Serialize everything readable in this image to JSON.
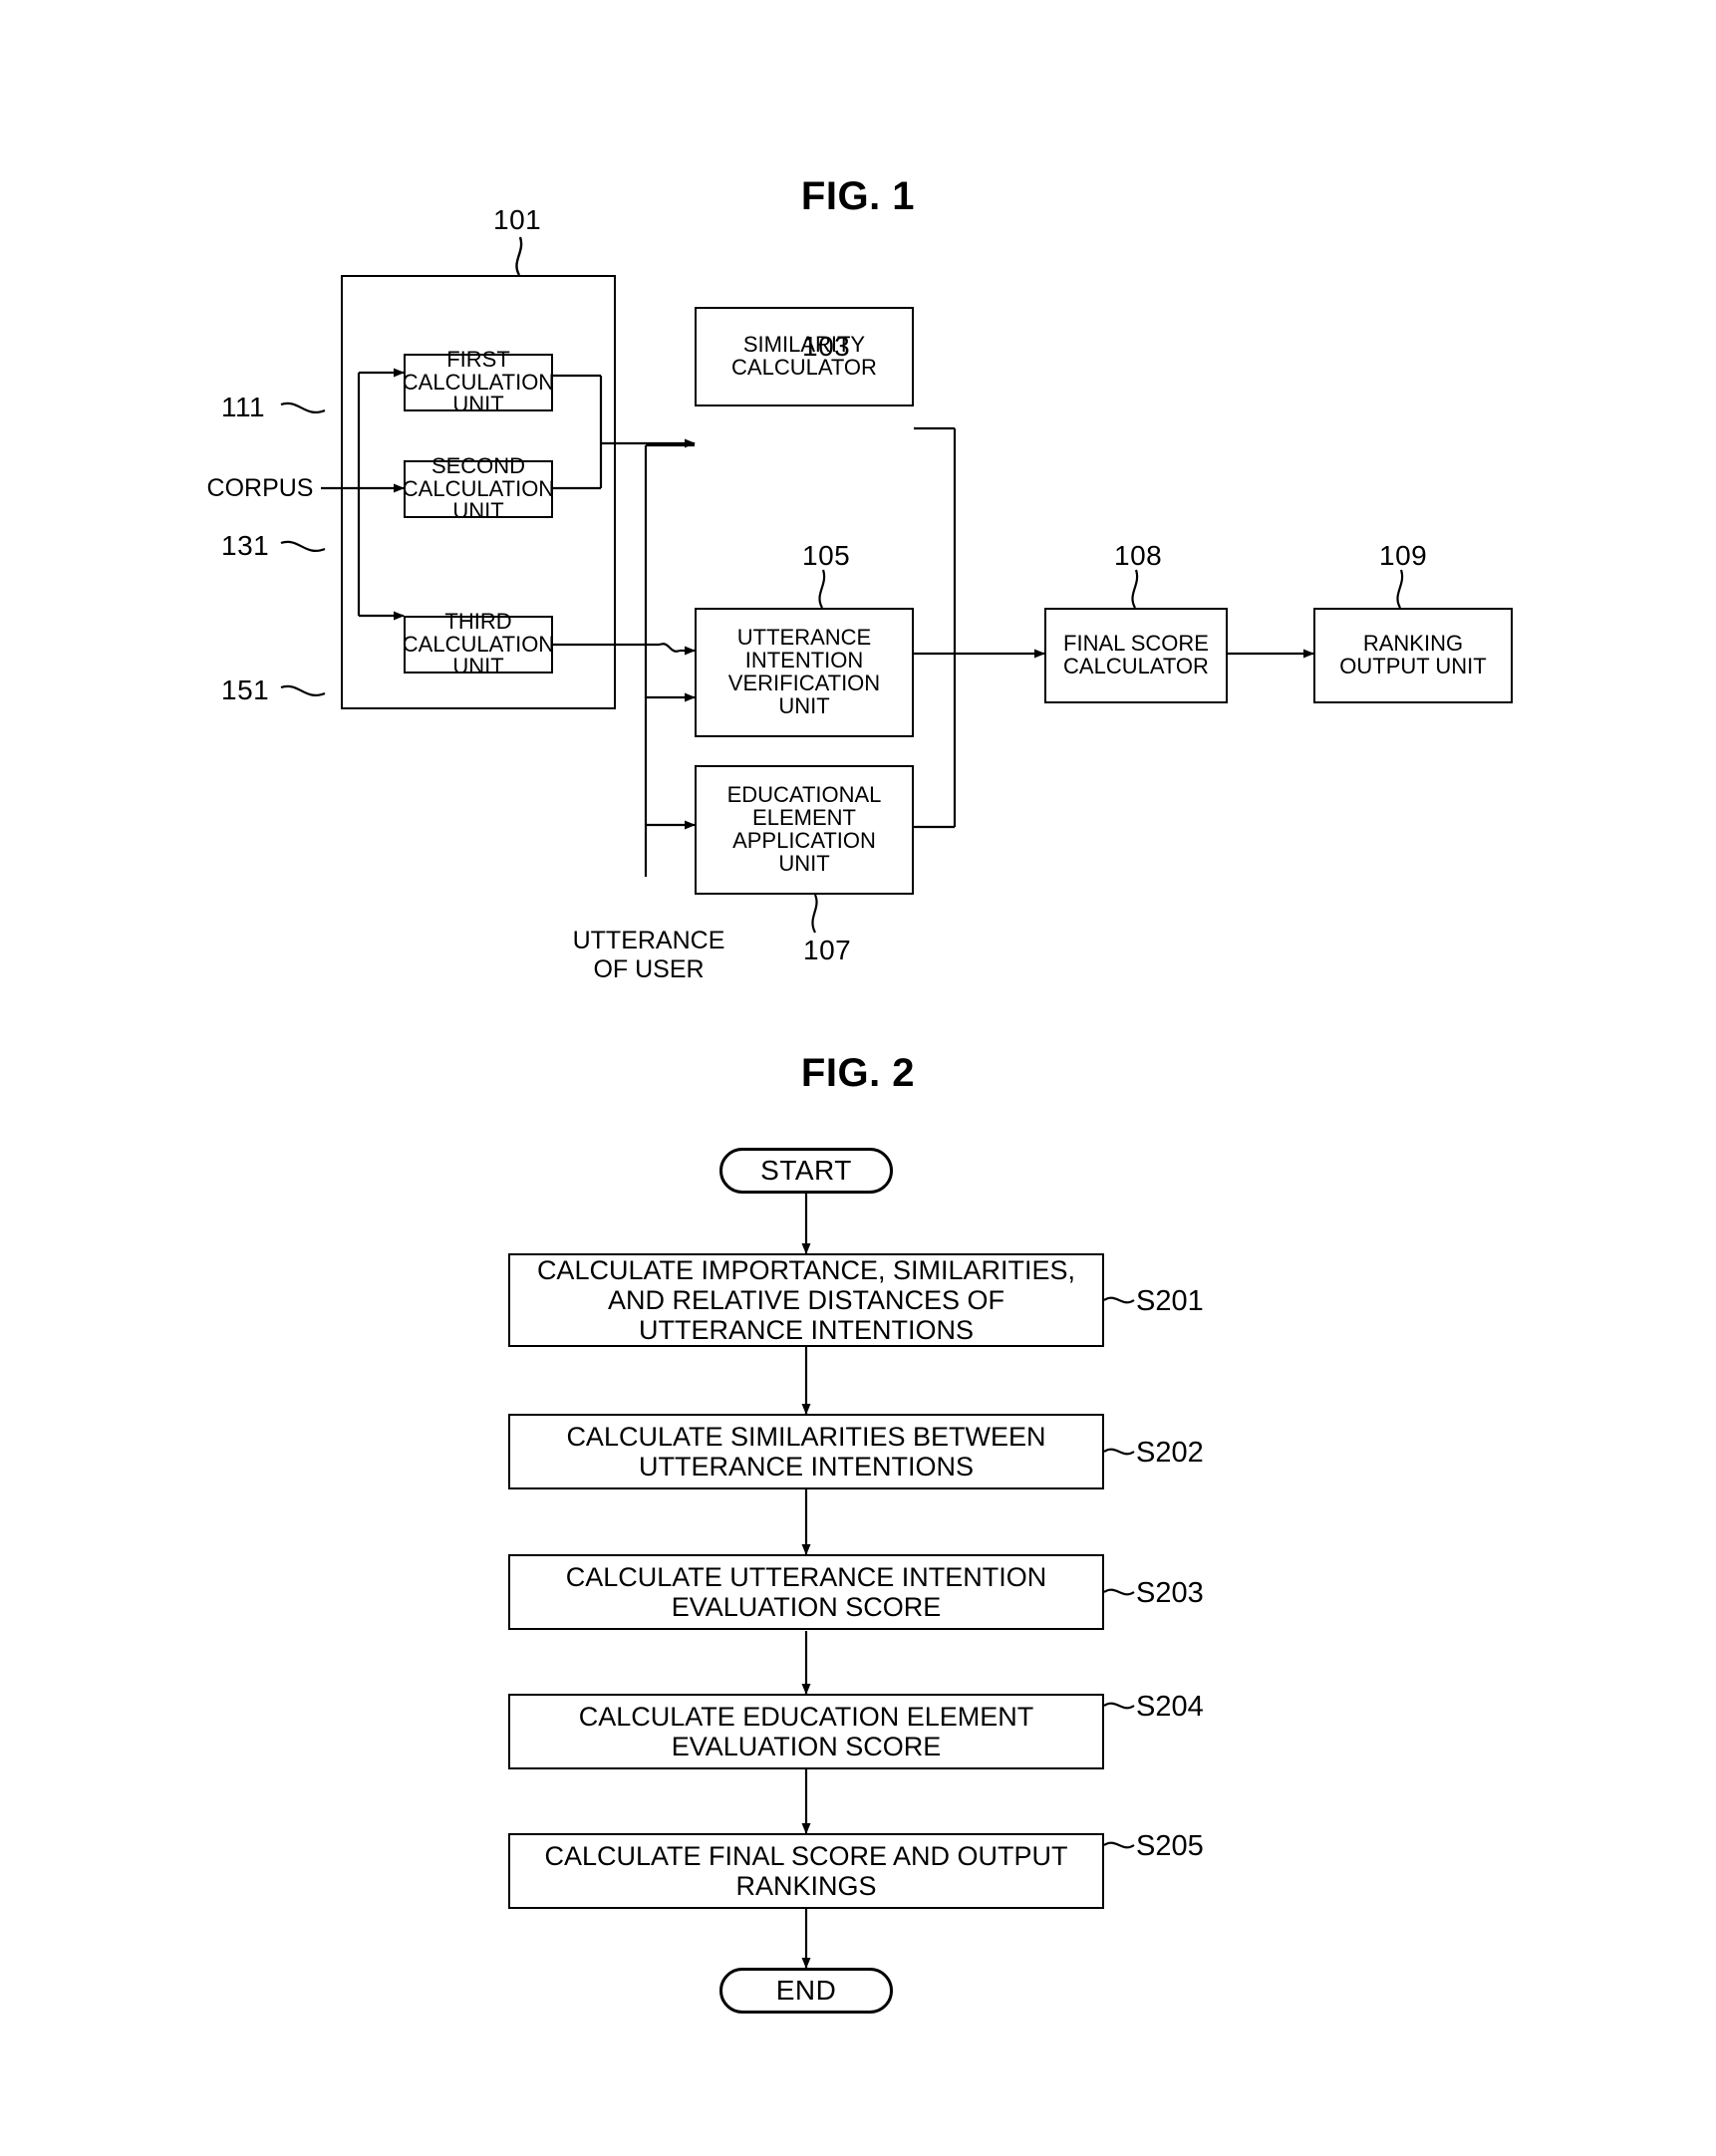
{
  "figures": {
    "fig1": {
      "title": "FIG. 1",
      "input_label": "CORPUS",
      "user_input_label": "UTTERANCE\nOF USER",
      "group_ref": "101",
      "blocks": [
        {
          "id": "first-calculation-unit",
          "label": "FIRST\nCALCULATION\nUNIT",
          "ref": "111"
        },
        {
          "id": "second-calculation-unit",
          "label": "SECOND\nCALCULATION\nUNIT",
          "ref": "131"
        },
        {
          "id": "third-calculation-unit",
          "label": "THIRD\nCALCULATION\nUNIT",
          "ref": "151"
        },
        {
          "id": "similarity-calculator",
          "label": "SIMILARITY\nCALCULATOR",
          "ref": "103"
        },
        {
          "id": "utterance-intention-verification-unit",
          "label": "UTTERANCE\nINTENTION\nVERIFICATION\nUNIT",
          "ref": "105"
        },
        {
          "id": "educational-element-application-unit",
          "label": "EDUCATIONAL\nELEMENT\nAPPLICATION\nUNIT",
          "ref": "107"
        },
        {
          "id": "final-score-calculator",
          "label": "FINAL SCORE\nCALCULATOR",
          "ref": "108"
        },
        {
          "id": "ranking-output-unit",
          "label": "RANKING\nOUTPUT UNIT",
          "ref": "109"
        }
      ]
    },
    "fig2": {
      "title": "FIG. 2",
      "start_label": "START",
      "end_label": "END",
      "steps": [
        {
          "id": "step-s201",
          "label": "CALCULATE IMPORTANCE, SIMILARITIES,\nAND RELATIVE DISTANCES OF\nUTTERANCE INTENTIONS",
          "ref": "S201"
        },
        {
          "id": "step-s202",
          "label": "CALCULATE SIMILARITIES BETWEEN\nUTTERANCE INTENTIONS",
          "ref": "S202"
        },
        {
          "id": "step-s203",
          "label": "CALCULATE UTTERANCE INTENTION\nEVALUATION SCORE",
          "ref": "S203"
        },
        {
          "id": "step-s204",
          "label": "CALCULATE EDUCATION ELEMENT\nEVALUATION SCORE",
          "ref": "S204"
        },
        {
          "id": "step-s205",
          "label": "CALCULATE FINAL SCORE AND OUTPUT\nRANKINGS",
          "ref": "S205"
        }
      ]
    }
  },
  "colors": {
    "ink": "#000000",
    "paper": "#ffffff"
  }
}
